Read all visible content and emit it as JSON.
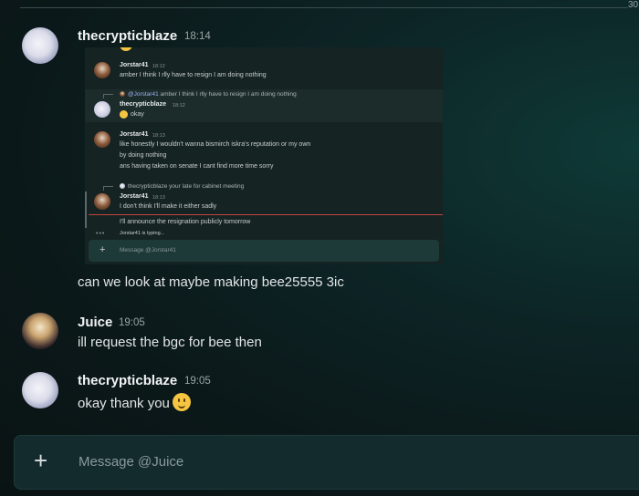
{
  "header": {
    "cut_label": "30"
  },
  "messages": [
    {
      "author": "thecrypticblaze",
      "time": "18:14",
      "text": "can we look at maybe making bee25555 3ic"
    },
    {
      "author": "Juice",
      "time": "19:05",
      "text": "ill request the bgc for bee then"
    },
    {
      "author": "thecrypticblaze",
      "time": "19:05",
      "text": "okay thank you"
    }
  ],
  "embed": {
    "m1": {
      "author": "Jorstar41",
      "time": "18:12",
      "text": "amber I think I rlly have to resign I am doing nothing"
    },
    "m2": {
      "reply_mention": "@Jorstar41",
      "reply_text": "amber I think I rlly have to resign I am doing nothing",
      "author": "thecrypticblaze",
      "time": "18:12",
      "text": "okay"
    },
    "m3": {
      "author": "Jorstar41",
      "time": "18:13",
      "lines": [
        "like honestly I wouldn't wanna bismirch iskra's reputation or my own",
        "by doing nothing",
        "ans having taken on senate I cant find more time sorry"
      ]
    },
    "m4": {
      "reply_mention": "thecrypticblaze",
      "reply_text": "your late for cabinet meeting",
      "author": "Jorstar41",
      "time": "18:13",
      "text": "I don't think I'll make it either sadly"
    },
    "m5": {
      "text": "I'll announce the resignation publicly tomorrow"
    },
    "typing": "Jorstar41 is typing...",
    "input_placeholder": "Message @Jorstar41"
  },
  "composer": {
    "placeholder": "Message @Juice"
  },
  "icons": {
    "plus": "plus-icon",
    "emoji": "slightly-smiling-face-emoji"
  }
}
